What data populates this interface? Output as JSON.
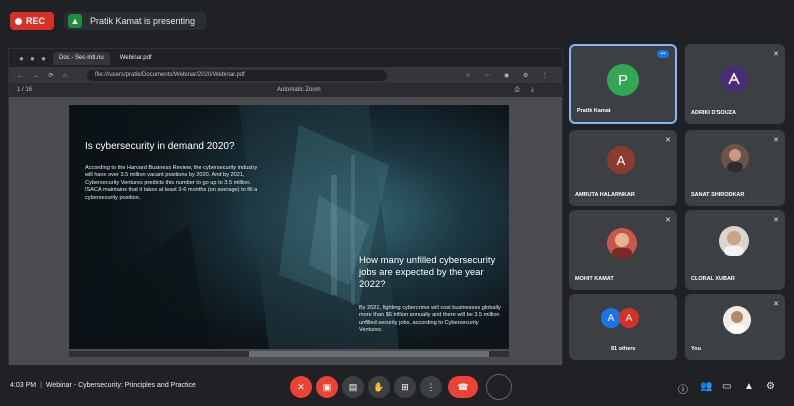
{
  "topbar": {
    "rec_label": "REC",
    "presenting_text": "Pratik Kamat is presenting"
  },
  "browser": {
    "tab_active": "Doc - Sec-mtl.nu",
    "tab_second": "Webinar.pdf",
    "address": "file:///users/pratik/Documents/Webinar/2020/Webinar.pdf",
    "pdf_left": "1 / 16",
    "zoom": "Automatic Zoom"
  },
  "slide": {
    "title1": "Is cybersecurity in demand 2020?",
    "body1": "According to the Harvard Business Review, the cybersecurity industry will have over 3.5 million vacant positions by 2020. And by 2021, Cybersecurity Ventures predicts this number to go up to 3.5 million. ISACA maintains that it takes at least 3-6 months (on average) to fill a cybersecurity position.",
    "title2": "How many unfilled cybersecurity jobs are expected by the year 2022?",
    "body2": "By 2021, fighting cybercrime will cost businesses globally more than $6 trillion annually and there will be 3.5 million unfilled security jobs, according to Cybersecurity Ventures."
  },
  "participants": [
    {
      "name": "Pratik Kamat",
      "initial": "P",
      "avatar_color": "#33a852"
    },
    {
      "name": "ADRIKI D'SOUZA",
      "initial": "A",
      "avatar_color": "#4a2a7a"
    },
    {
      "name": "AMRUTA HALARNKAR",
      "initial": "A",
      "avatar_color": "#8d3b2e"
    },
    {
      "name": "SANAT SHIRODKAR",
      "initial": "",
      "avatar_color": "#6b5448"
    },
    {
      "name": "MOHIT KAMAT",
      "initial": "",
      "avatar_color": "#c8574a"
    },
    {
      "name": "CLORAL XUBAR",
      "initial": "",
      "avatar_color": "#d9d5cf"
    },
    {
      "name": "81 others",
      "initial": "A",
      "avatar_color": "#1a73e8"
    },
    {
      "name": "You",
      "initial": "",
      "avatar_color": "#efece6"
    }
  ],
  "bottom": {
    "time": "4:03 PM",
    "meeting_title": "Webinar - Cybersecurity: Principles and Practice"
  },
  "colors": {
    "accent": "#8ab4f8",
    "danger": "#ea4335",
    "bar": "#1f2125"
  }
}
